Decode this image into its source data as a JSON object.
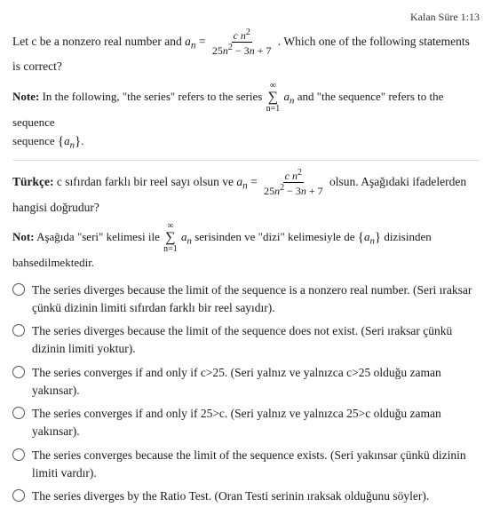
{
  "header": {
    "label": "Kalan Süre 1:13"
  },
  "question": {
    "intro": "Let c be a nonzero real number and",
    "an_def": "a_n =",
    "fraction": {
      "num": "c n²",
      "den": "25n² − 3n + 7"
    },
    "suffix": ". Which one of the following statements is correct?",
    "note_label": "Note:",
    "note_text": "In the following, \"the series\" refers to the series",
    "note_series": "∑ aₙ",
    "note_series_from": "n=1",
    "note_series_to": "∞",
    "note_and": "and \"the sequence\" refers to the sequence",
    "note_sequence": "{aₙ}.",
    "turkish_label": "Türkçe:",
    "turkish_text": "c sıfırdan farklı bir reel sayı olsun ve a_n =",
    "turkish_fraction": {
      "num": "c n²",
      "den": "25n² − 3n + 7"
    },
    "turkish_suffix": "olsun. Aşağıdaki ifadelerden hangisi doğrudur?",
    "note_turkish_label": "Not:",
    "note_turkish_text": "Aşağıda \"seri\" kelimesi ile",
    "note_turkish_series": "∑ aₙ",
    "note_turkish_from": "n=1",
    "note_turkish_to": "∞",
    "note_turkish_mid": "serisinden ve \"dizi\" kelimesiyle de",
    "note_turkish_seq": "{aₙ}",
    "note_turkish_end": "dizisinden bahsedilmektedir."
  },
  "options": [
    {
      "id": "A",
      "text": "The series diverges because the limit of the sequence is a nonzero real number. (Seri ıraksar çünkü dizinin limiti sıfırdan farklı bir reel sayıdır)."
    },
    {
      "id": "B",
      "text": "The series diverges because the limit of the sequence does not exist. (Seri ıraksar çünkü dizinin limiti yoktur)."
    },
    {
      "id": "C",
      "text": "The series converges if and only if c>25. (Seri yalnız ve yalnızca c>25 olduğu zaman yakınsar)."
    },
    {
      "id": "D",
      "text": "The series converges if and only if 25>c. (Seri yalnız ve yalnızca 25>c olduğu zaman yakınsar)."
    },
    {
      "id": "E",
      "text": "The series converges because the limit of the sequence exists. (Seri yakınsar çünkü dizinin limiti vardır)."
    },
    {
      "id": "F",
      "text": "The series diverges by the Ratio Test. (Oran Testi serinin ıraksak olduğunu söyler)."
    }
  ]
}
